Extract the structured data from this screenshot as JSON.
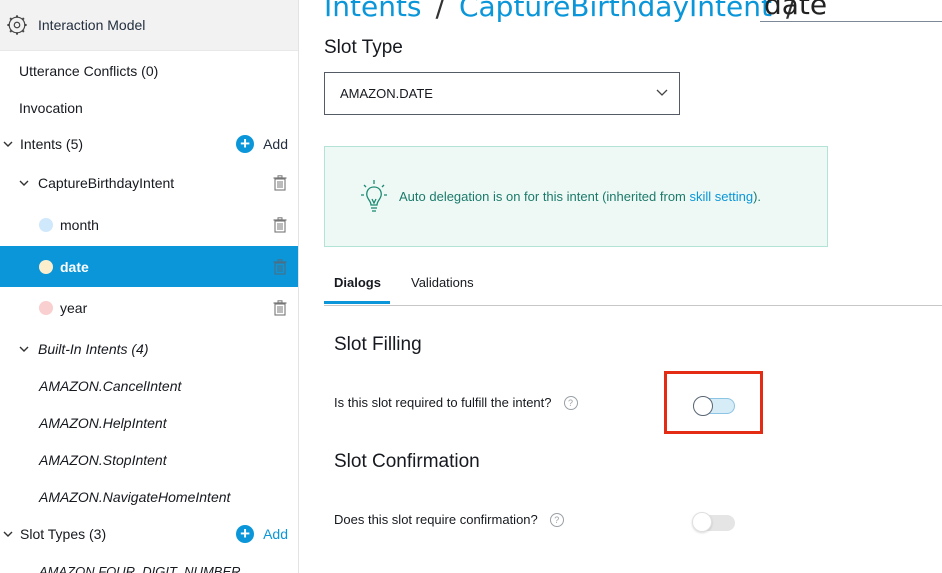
{
  "sidebar": {
    "header_title": "Interaction Model",
    "utterance_conflicts": "Utterance Conflicts (0)",
    "invocation": "Invocation",
    "intents": {
      "label": "Intents (5)",
      "add_label": "Add"
    },
    "capture_intent": "CaptureBirthdayIntent",
    "slots": [
      {
        "label": "month",
        "color": "#cfe8fb"
      },
      {
        "label": "date",
        "color": "#fbeecd"
      },
      {
        "label": "year",
        "color": "#f9cfcf"
      }
    ],
    "builtin": {
      "label": "Built-In Intents (4)",
      "items": [
        "AMAZON.CancelIntent",
        "AMAZON.HelpIntent",
        "AMAZON.StopIntent",
        "AMAZON.NavigateHomeIntent"
      ]
    },
    "slot_types": {
      "label": "Slot Types (3)",
      "add_label": "Add"
    },
    "slot_type_partial": "AMAZON.FOUR_DIGIT_NUMBER"
  },
  "breadcrumb": {
    "intents": "Intents",
    "sep1": "/",
    "intent": "CaptureBirthdayIntent",
    "sep2": "/",
    "slot_name": "date"
  },
  "slot_type": {
    "title": "Slot Type",
    "selected": "AMAZON.DATE"
  },
  "info": {
    "text_before": "Auto delegation is on for this intent (inherited from ",
    "link": "skill setting",
    "text_after": ")."
  },
  "tabs": [
    {
      "label": "Dialogs",
      "active": true
    },
    {
      "label": "Validations",
      "active": false
    }
  ],
  "slot_filling": {
    "title": "Slot Filling",
    "question": "Is this slot required to fulfill the intent?",
    "help": "?",
    "toggle_on": false
  },
  "slot_confirmation": {
    "title": "Slot Confirmation",
    "question": "Does this slot require confirmation?",
    "help": "?",
    "toggle_on": false
  },
  "colors": {
    "accent": "#0a96d8",
    "highlight_box": "#e42b14",
    "info_bg": "#eef9f6",
    "info_text": "#1c7a6a"
  }
}
